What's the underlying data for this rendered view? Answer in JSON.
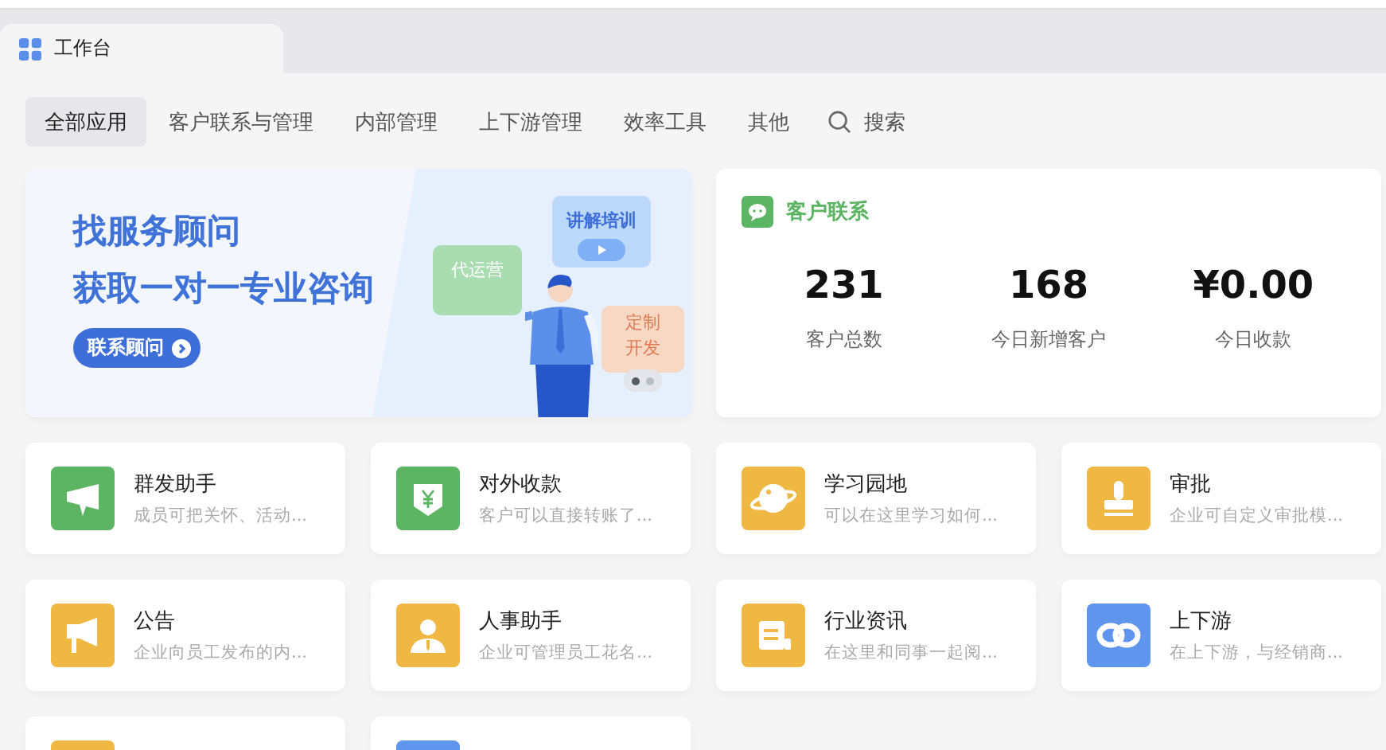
{
  "tab": {
    "title": "工作台"
  },
  "nav": {
    "items": [
      {
        "label": "全部应用",
        "selected": true
      },
      {
        "label": "客户联系与管理",
        "selected": false
      },
      {
        "label": "内部管理",
        "selected": false
      },
      {
        "label": "上下游管理",
        "selected": false
      },
      {
        "label": "效率工具",
        "selected": false
      },
      {
        "label": "其他",
        "selected": false
      }
    ],
    "search": "搜索"
  },
  "banner": {
    "headline": [
      "找服务顾问",
      "获取一对一专业咨询"
    ],
    "button": "联系顾问",
    "tags": [
      {
        "kind": "operate",
        "lines": [
          "代运营"
        ]
      },
      {
        "kind": "training",
        "lines": [
          "讲解培训"
        ]
      },
      {
        "kind": "custom",
        "lines": [
          "定制",
          "开发"
        ]
      }
    ],
    "slides": [
      {
        "selected": true
      },
      {
        "selected": false
      }
    ]
  },
  "customer_contact": {
    "title": "客户联系",
    "stats": [
      {
        "value": "231",
        "label": "客户总数"
      },
      {
        "value": "168",
        "label": "今日新增客户"
      },
      {
        "value": "¥0.00",
        "label": "今日收款"
      }
    ]
  },
  "apps": [
    {
      "kind": "megaphone",
      "color": "#5cb563",
      "title": "群发助手",
      "description": "成员可把关怀、活动..."
    },
    {
      "kind": "payment",
      "color": "#5cb563",
      "title": "对外收款",
      "description": "客户可以直接转账了..."
    },
    {
      "kind": "planet",
      "color": "#efb843",
      "title": "学习园地",
      "description": "可以在这里学习如何..."
    },
    {
      "kind": "stamp",
      "color": "#efb843",
      "title": "审批",
      "description": "企业可自定义审批模..."
    },
    {
      "kind": "bullhorn",
      "color": "#efb843",
      "title": "公告",
      "description": "企业向员工发布的内..."
    },
    {
      "kind": "person",
      "color": "#efb843",
      "title": "人事助手",
      "description": "企业可管理员工花名..."
    },
    {
      "kind": "document",
      "color": "#efb843",
      "title": "行业资讯",
      "description": "在这里和同事一起阅..."
    },
    {
      "kind": "link",
      "color": "#5f95ec",
      "title": "上下游",
      "description": "在上下游，与经销商..."
    },
    {
      "kind": "hidden",
      "color": "#efb843"
    },
    {
      "kind": "hidden",
      "color": "#5f95ec"
    }
  ]
}
